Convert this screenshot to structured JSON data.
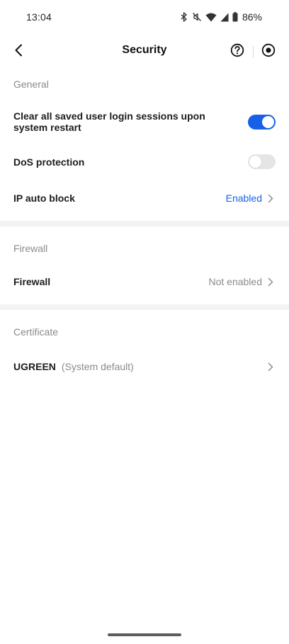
{
  "status_bar": {
    "time": "13:04",
    "battery": "86%",
    "icons": [
      "bluetooth-icon",
      "mute-icon",
      "wifi-icon",
      "signal-icon",
      "battery-icon"
    ]
  },
  "header": {
    "title": "Security",
    "icons": [
      "back-arrow-icon",
      "help-icon",
      "record-icon"
    ]
  },
  "general": {
    "section_label": "General",
    "clear_sessions": {
      "label": "Clear all saved user login sessions upon system restart",
      "enabled": true
    },
    "dos_protection": {
      "label": "DoS protection",
      "enabled": false
    },
    "ip_auto_block": {
      "label": "IP auto block",
      "value": "Enabled"
    }
  },
  "firewall": {
    "section_label": "Firewall",
    "item": {
      "label": "Firewall",
      "value": "Not enabled"
    }
  },
  "certificate": {
    "section_label": "Certificate",
    "item": {
      "label": "UGREEN",
      "default_note": "(System default)"
    }
  },
  "colors": {
    "accent": "#1661e8",
    "toggle_off": "#e5e5e8",
    "muted_text": "#8a8a8e",
    "separator": "#f3f3f3"
  }
}
